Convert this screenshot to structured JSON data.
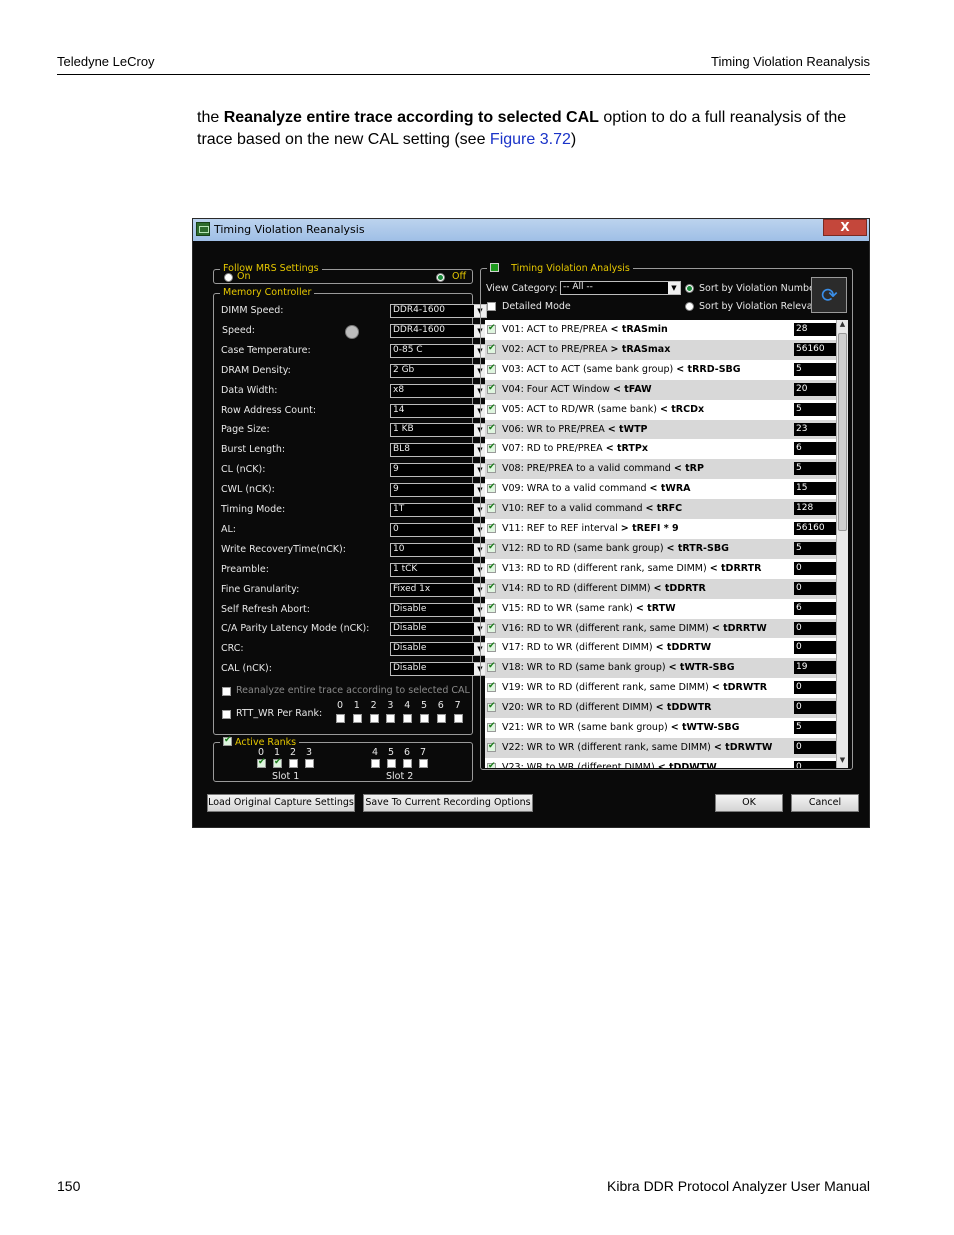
{
  "header": {
    "left": "Teledyne LeCroy",
    "right": "Timing Violation Reanalysis"
  },
  "paragraph": {
    "pre": "the ",
    "bold": "Reanalyze entire trace according to selected CAL",
    "mid": " option to do a full reanalysis of the trace based on the new CAL setting (see ",
    "link": "Figure 3.72",
    "post": ")"
  },
  "footer": {
    "page": "150",
    "title": "Kibra DDR Protocol Analyzer User Manual"
  },
  "dialog": {
    "title": "Timing Violation Reanalysis",
    "close_glyph": "X",
    "follow_mrs": {
      "title": "Follow MRS Settings",
      "on_label": "On",
      "off_label": "Off",
      "selected": "Off"
    },
    "memory_controller": {
      "title": "Memory Controller",
      "fields": [
        {
          "label": "DIMM Speed:",
          "value": "DDR4-1600"
        },
        {
          "label": "Speed:",
          "value": "DDR4-1600"
        },
        {
          "label": "Case Temperature:",
          "value": "0-85 C"
        },
        {
          "label": "DRAM Density:",
          "value": "2 Gb"
        },
        {
          "label": "Data Width:",
          "value": "x8"
        },
        {
          "label": "Row Address Count:",
          "value": "14"
        },
        {
          "label": "Page Size:",
          "value": "1 KB"
        },
        {
          "label": "Burst Length:",
          "value": "BL8"
        },
        {
          "label": "CL (nCK):",
          "value": "9"
        },
        {
          "label": "CWL (nCK):",
          "value": "9"
        },
        {
          "label": "Timing Mode:",
          "value": "1T"
        },
        {
          "label": "AL:",
          "value": "0"
        },
        {
          "label": "Write RecoveryTime(nCK):",
          "value": "10"
        },
        {
          "label": "Preamble:",
          "value": "1 tCK"
        },
        {
          "label": "Fine Granularity:",
          "value": "Fixed 1x"
        },
        {
          "label": "Self Refresh Abort:",
          "value": "Disable"
        },
        {
          "label": "C/A Parity Latency Mode (nCK):",
          "value": "Disable"
        },
        {
          "label": "CRC:",
          "value": "Disable"
        },
        {
          "label": "CAL (nCK):",
          "value": "Disable"
        }
      ],
      "reanalyze_label": "Reanalyze entire trace according to selected CAL",
      "rtt_label": "RTT_WR Per Rank:",
      "rtt_ranks": [
        "0",
        "1",
        "2",
        "3",
        "4",
        "5",
        "6",
        "7"
      ]
    },
    "active_ranks": {
      "title": "Active Ranks",
      "slot1_ranks": [
        "0",
        "1",
        "2",
        "3"
      ],
      "slot2_ranks": [
        "4",
        "5",
        "6",
        "7"
      ],
      "slot1_label": "Slot 1",
      "slot2_label": "Slot 2"
    },
    "analysis": {
      "title": "Timing Violation Analysis",
      "view_category_label": "View Category:",
      "view_category_value": "-- All --",
      "detailed_mode_label": "Detailed Mode",
      "sort_number_label": "Sort by Violation Numbe",
      "sort_relevance_label": "Sort by Violation Releva",
      "violations": [
        {
          "text": "V01: ACT to PRE/PREA ",
          "rel": "< ",
          "param": "tRASmin",
          "value": "28"
        },
        {
          "text": "V02: ACT to PRE/PREA ",
          "rel": "> ",
          "param": "tRASmax",
          "value": "56160"
        },
        {
          "text": "V03: ACT to ACT (same bank group) ",
          "rel": "< ",
          "param": "tRRD-SBG",
          "value": "5"
        },
        {
          "text": "V04: Four ACT Window ",
          "rel": "< ",
          "param": "tFAW",
          "value": "20"
        },
        {
          "text": "V05: ACT to RD/WR (same bank) ",
          "rel": "< ",
          "param": "tRCDx",
          "value": "5"
        },
        {
          "text": "V06: WR to PRE/PREA ",
          "rel": "< ",
          "param": "tWTP",
          "value": "23"
        },
        {
          "text": "V07: RD to PRE/PREA ",
          "rel": "< ",
          "param": "tRTPx",
          "value": "6"
        },
        {
          "text": "V08: PRE/PREA to a valid command ",
          "rel": "< ",
          "param": "tRP",
          "value": "5"
        },
        {
          "text": "V09: WRA to a valid command ",
          "rel": "< ",
          "param": "tWRA",
          "value": "15"
        },
        {
          "text": "V10: REF to a valid command ",
          "rel": "< ",
          "param": "tRFC",
          "value": "128"
        },
        {
          "text": "V11: REF to REF interval ",
          "rel": "> ",
          "param": "tREFI * 9",
          "value": "56160"
        },
        {
          "text": "V12: RD to RD (same bank group) ",
          "rel": "< ",
          "param": "tRTR-SBG",
          "value": "5"
        },
        {
          "text": "V13: RD to RD (different rank, same DIMM) ",
          "rel": "< ",
          "param": "tDRRTR",
          "value": "0"
        },
        {
          "text": "V14: RD to RD (different DIMM) ",
          "rel": "< ",
          "param": "tDDRTR",
          "value": "0"
        },
        {
          "text": "V15: RD to WR (same rank) ",
          "rel": "< ",
          "param": "tRTW",
          "value": "6"
        },
        {
          "text": "V16: RD to WR (different rank, same DIMM) ",
          "rel": "< ",
          "param": "tDRRTW",
          "value": "0"
        },
        {
          "text": "V17: RD to WR (different DIMM) ",
          "rel": "< ",
          "param": "tDDRTW",
          "value": "0"
        },
        {
          "text": "V18: WR to RD (same bank group) ",
          "rel": "< ",
          "param": "tWTR-SBG",
          "value": "19"
        },
        {
          "text": "V19: WR to RD (different rank, same DIMM) ",
          "rel": "< ",
          "param": "tDRWTR",
          "value": "0"
        },
        {
          "text": "V20: WR to RD (different DIMM) ",
          "rel": "< ",
          "param": "tDDWTR",
          "value": "0"
        },
        {
          "text": "V21: WR to WR (same bank group) ",
          "rel": "< ",
          "param": "tWTW-SBG",
          "value": "5"
        },
        {
          "text": "V22: WR to WR (different rank, same DIMM) ",
          "rel": "< ",
          "param": "tDRWTW",
          "value": "0"
        },
        {
          "text": "V23: WR to WR (different DIMM) ",
          "rel": "< ",
          "param": "tDDWTW",
          "value": "0"
        }
      ]
    },
    "buttons": {
      "load": "Load Original Capture Settings",
      "save": "Save To Current Recording Options",
      "ok": "OK",
      "cancel": "Cancel"
    }
  }
}
